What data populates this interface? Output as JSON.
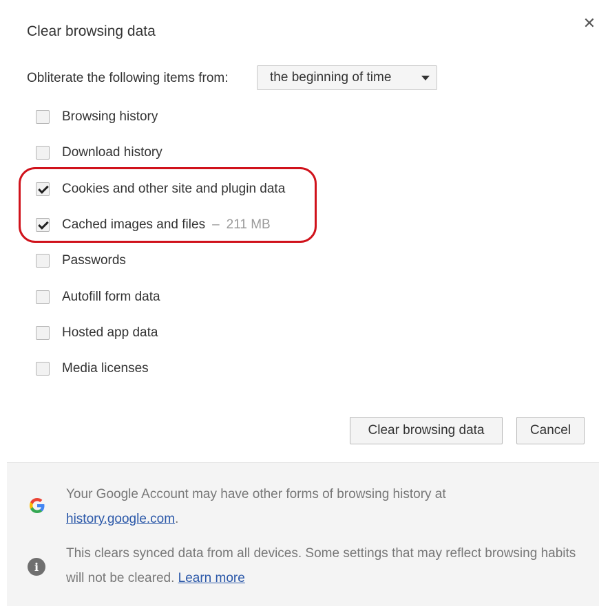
{
  "dialog": {
    "title": "Clear browsing data",
    "close_icon": "close-icon"
  },
  "time_range": {
    "label": "Obliterate the following items from:",
    "selected": "the beginning of time"
  },
  "options": [
    {
      "label": "Browsing history",
      "checked": false,
      "extra": ""
    },
    {
      "label": "Download history",
      "checked": false,
      "extra": ""
    },
    {
      "label": "Cookies and other site and plugin data",
      "checked": true,
      "extra": ""
    },
    {
      "label": "Cached images and files",
      "checked": true,
      "separator": "–",
      "extra": "211 MB"
    },
    {
      "label": "Passwords",
      "checked": false,
      "extra": ""
    },
    {
      "label": "Autofill form data",
      "checked": false,
      "extra": ""
    },
    {
      "label": "Hosted app data",
      "checked": false,
      "extra": ""
    },
    {
      "label": "Media licenses",
      "checked": false,
      "extra": ""
    }
  ],
  "buttons": {
    "clear_label": "Clear browsing data",
    "cancel_label": "Cancel"
  },
  "footer": {
    "google_note": {
      "icon": "google-g-icon",
      "text": "Your Google Account may have other forms of browsing history at",
      "link": "history.google.com",
      "suffix": "."
    },
    "sync_note": {
      "icon": "info-icon",
      "text": "This clears synced data from all devices. Some settings that may reflect browsing habits will not be cleared.",
      "link": "Learn more"
    }
  },
  "colors": {
    "highlight": "#d0121b",
    "link": "#2a57a8",
    "footer_bg": "#f4f4f4"
  }
}
